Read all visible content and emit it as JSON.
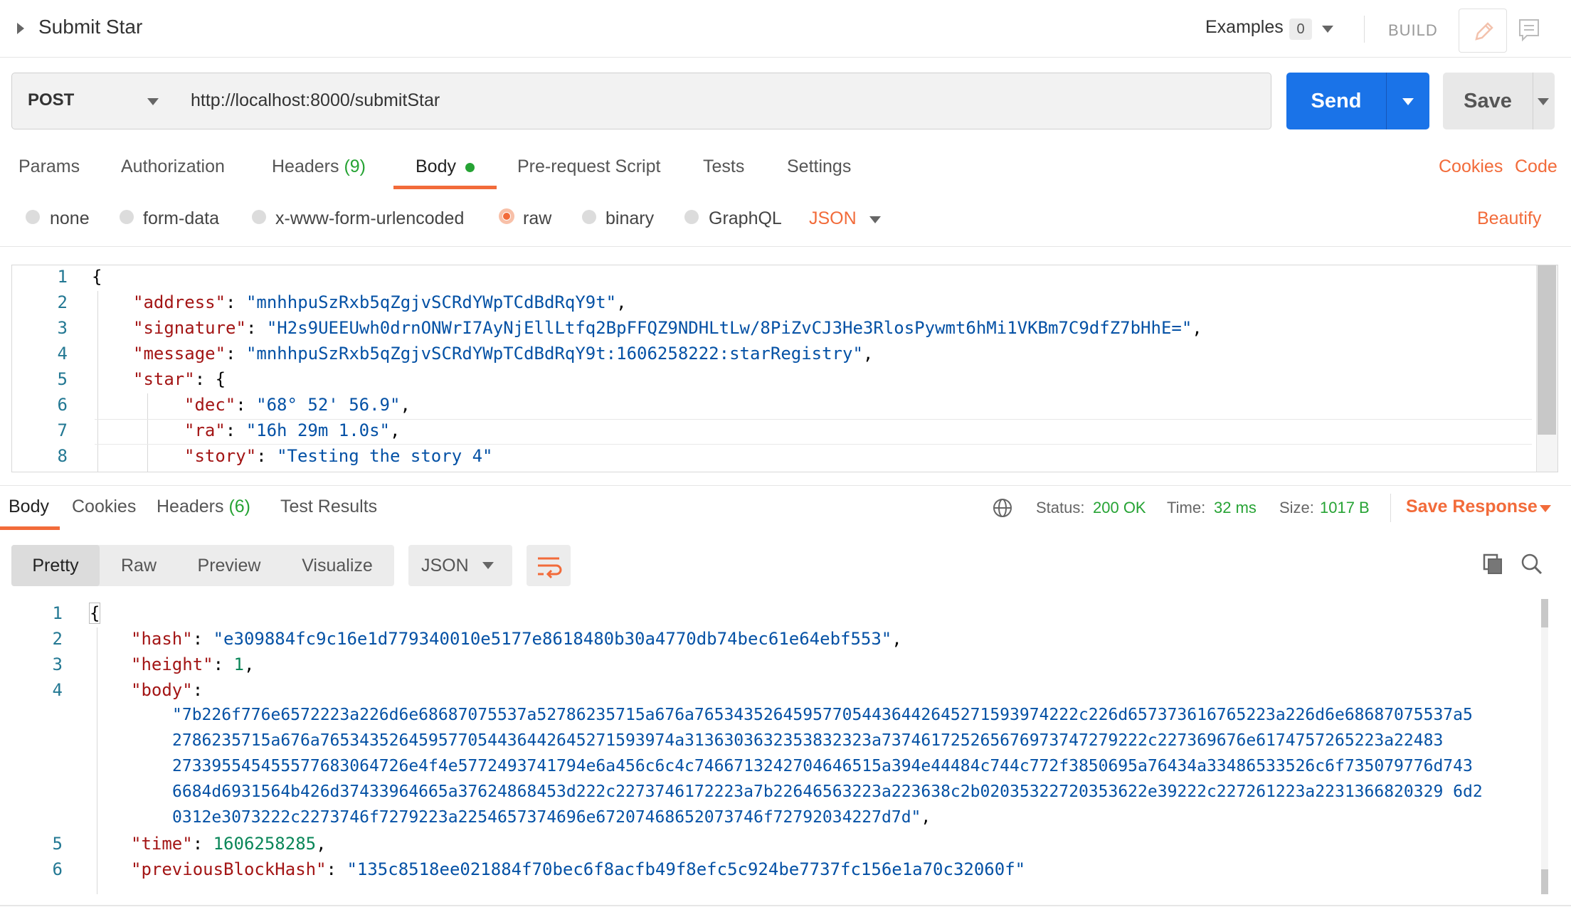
{
  "header": {
    "title": "Submit Star",
    "examples_label": "Examples",
    "examples_count": "0",
    "build_label": "BUILD"
  },
  "request": {
    "method": "POST",
    "url": "http://localhost:8000/submitStar",
    "send_label": "Send",
    "save_label": "Save"
  },
  "request_tabs": {
    "params": "Params",
    "authorization": "Authorization",
    "headers": "Headers",
    "headers_count": "(9)",
    "body": "Body",
    "prerequest": "Pre-request Script",
    "tests": "Tests",
    "settings": "Settings",
    "cookies": "Cookies",
    "code": "Code"
  },
  "body_types": {
    "none": "none",
    "form_data": "form-data",
    "urlencoded": "x-www-form-urlencoded",
    "raw": "raw",
    "binary": "binary",
    "graphql": "GraphQL",
    "format": "JSON",
    "beautify": "Beautify",
    "selected": "raw"
  },
  "request_body": {
    "line_numbers": [
      "1",
      "2",
      "3",
      "4",
      "5",
      "6",
      "7",
      "8"
    ],
    "open_brace": "{",
    "address_key": "\"address\"",
    "address_val": "\"mnhhpuSzRxb5qZgjvSCRdYWpTCdBdRqY9t\"",
    "signature_key": "\"signature\"",
    "signature_val": "\"H2s9UEEUwh0drnONWrI7AyNjEllLtfq2BpFFQZ9NDHLtLw/8PiZvCJ3He3RlosPywmt6hMi1VKBm7C9dfZ7bHhE=\"",
    "message_key": "\"message\"",
    "message_val": "\"mnhhpuSzRxb5qZgjvSCRdYWpTCdBdRqY9t:1606258222:starRegistry\"",
    "star_key": "\"star\"",
    "dec_key": "\"dec\"",
    "dec_val": "\"68° 52' 56.9\"",
    "ra_key": "\"ra\"",
    "ra_val": "\"16h 29m 1.0s\"",
    "story_key": "\"story\"",
    "story_val": "\"Testing the story 4\""
  },
  "response_tabs": {
    "body": "Body",
    "cookies": "Cookies",
    "headers": "Headers",
    "headers_count": "(6)",
    "test_results": "Test Results"
  },
  "response_status": {
    "status_label": "Status:",
    "status_value": "200 OK",
    "time_label": "Time:",
    "time_value": "32 ms",
    "size_label": "Size:",
    "size_value": "1017 B",
    "save_response": "Save Response"
  },
  "response_view": {
    "pretty": "Pretty",
    "raw": "Raw",
    "preview": "Preview",
    "visualize": "Visualize",
    "format": "JSON",
    "active": "Pretty"
  },
  "response_body": {
    "line_numbers": [
      "1",
      "2",
      "3",
      "4",
      "5",
      "6"
    ],
    "open_brace": "{",
    "hash_key": "\"hash\"",
    "hash_val": "\"e309884fc9c16e1d779340010e5177e8618480b30a4770db74bec61e64ebf553\"",
    "height_key": "\"height\"",
    "height_val": "1",
    "body_key": "\"body\"",
    "body_lines": [
      "\"7b226f776e6572223a226d6e68687075537a52786235715a676a765343526459577054436442645271593974222c226d657373616765223a226d6e68687075537a5",
      "2786235715a676a765343526459577054436442645271593974a3136303632353832323a737461725265676973747279222c227369676e6174757265223a22483",
      "273395545455577683064726e4f4e5772493741794e6a456c6c4c7466713242704646515a394e44484c744c772f3850695a76434a33486533526c6f735079776d743",
      "6684d6931564b426d37433964665a37624868453d222c2273746172223a7b22646563223a223638c2b02035322720353622e39222c227261223a2231366820329 6d2",
      "0312e3073222c2273746f7279223a2254657374696e67207468652073746f72792034227d7d\""
    ],
    "time_key": "\"time\"",
    "time_val": "1606258285",
    "prev_key": "\"previousBlockHash\"",
    "prev_val": "\"135c8518ee021884f70bec6f8acfb49f8efc5c924be7737fc156e1a70c32060f\""
  },
  "colors": {
    "accent": "#f26b3a",
    "send_blue": "#1a73e8",
    "success_green": "#26a334",
    "json_key": "#a31515",
    "json_string": "#0451a5",
    "json_number": "#098658"
  },
  "icons": [
    "chevron-right-icon",
    "chevron-down-icon",
    "pencil-icon",
    "comment-icon",
    "globe-icon",
    "wrap-lines-icon",
    "copy-icon",
    "search-icon"
  ]
}
